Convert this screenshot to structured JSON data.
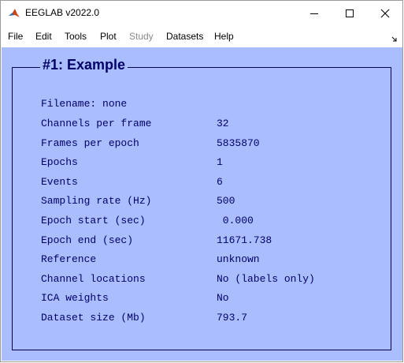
{
  "window": {
    "title": "EEGLAB v2022.0",
    "icon": "matlab-icon",
    "controls": [
      "minimize-icon",
      "maximize-icon",
      "close-icon"
    ]
  },
  "menu": {
    "items": [
      {
        "label": "File",
        "enabled": true
      },
      {
        "label": "Edit",
        "enabled": true
      },
      {
        "label": "Tools",
        "enabled": true
      },
      {
        "label": "Plot",
        "enabled": true
      },
      {
        "label": "Study",
        "enabled": false
      },
      {
        "label": "Datasets",
        "enabled": true
      },
      {
        "label": "Help",
        "enabled": true
      }
    ],
    "dock_icon": "undock-arrow-icon"
  },
  "panel": {
    "title": "#1: Example",
    "filename": "Filename: none",
    "rows": [
      {
        "label": "Channels per frame",
        "value": "32"
      },
      {
        "label": "Frames per epoch",
        "value": "5835870"
      },
      {
        "label": "Epochs",
        "value": "1"
      },
      {
        "label": "Events",
        "value": "6"
      },
      {
        "label": "Sampling rate (Hz)",
        "value": "500"
      },
      {
        "label": "Epoch start (sec)",
        "value": " 0.000"
      },
      {
        "label": "Epoch end (sec)",
        "value": "11671.738"
      },
      {
        "label": "Reference",
        "value": "unknown"
      },
      {
        "label": "Channel locations",
        "value": "No (labels only)"
      },
      {
        "label": "ICA weights",
        "value": "No"
      },
      {
        "label": "Dataset size (Mb)",
        "value": "793.7"
      }
    ]
  },
  "colors": {
    "background": "#aabeff",
    "text": "#000066",
    "disabled_menu": "#8a8a8a"
  }
}
